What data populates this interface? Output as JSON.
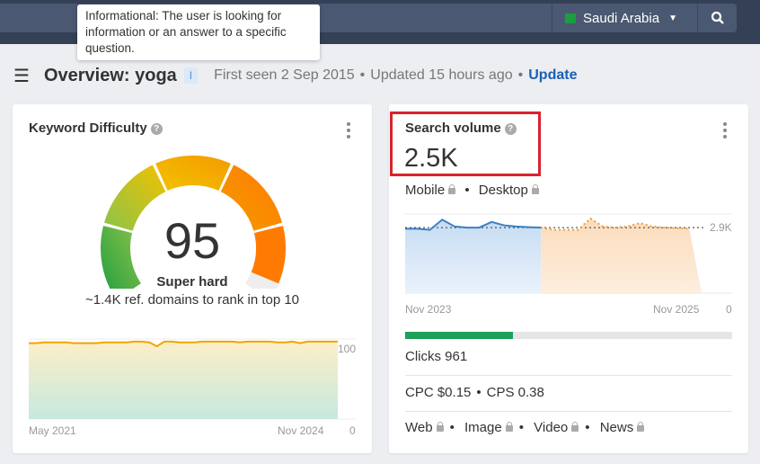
{
  "topbar": {
    "country": "Saudi Arabia",
    "search_icon": "search-icon",
    "flag_icon": "saudi-flag-icon"
  },
  "tooltip": {
    "text": "Informational: The user is looking for information or an answer to a specific question."
  },
  "header": {
    "title": "Overview: yoga",
    "intent_badge": "I",
    "first_seen": "First seen 2 Sep 2015",
    "updated": "Updated 15 hours ago",
    "update_link": "Update"
  },
  "kd": {
    "title": "Keyword Difficulty",
    "value": "95",
    "value_num": 95,
    "label": "Super hard",
    "sub": "~1.4K ref. domains to rank in top 10",
    "gauge_colors": [
      "#1f9d3f",
      "#8bc34a",
      "#f2c200",
      "#f59b00",
      "#ff7a00"
    ],
    "chart_data": {
      "type": "area",
      "x_start": "May 2021",
      "x_end": "Nov 2024",
      "ymax_label": "100",
      "ymin_label": "0",
      "ylim": [
        0,
        100
      ],
      "values": [
        97,
        97,
        98,
        98,
        98,
        98,
        97,
        97,
        97,
        97,
        98,
        98,
        98,
        98,
        99,
        99,
        98,
        93,
        99,
        99,
        98,
        98,
        98,
        99,
        99,
        99,
        99,
        99,
        98,
        99,
        99,
        99,
        99,
        98,
        98,
        99,
        97,
        99,
        99,
        99,
        99,
        99
      ]
    }
  },
  "sv": {
    "title": "Search volume",
    "value": "2.5K",
    "mobile": "Mobile",
    "desktop": "Desktop",
    "highlight_color": "#d9232d",
    "chart_data": {
      "type": "area",
      "x_start": "Nov 2023",
      "x_end": "Nov 2025",
      "ref_label": "2.9K",
      "ref_value": 2900,
      "ymin_label": "0",
      "ylim": [
        0,
        3500
      ],
      "actual": [
        2850,
        2850,
        2800,
        3250,
        2950,
        2900,
        2900,
        3150,
        3000,
        2950,
        2920,
        2900
      ],
      "forecast": [
        2900,
        2800,
        2800,
        2800,
        3300,
        2950,
        2900,
        2950,
        3100,
        2950,
        2900,
        2880,
        2850
      ]
    },
    "clicks": "Clicks 961",
    "clicks_fraction": 0.33,
    "cpc": "CPC $0.15",
    "cps": "CPS 0.38",
    "types": [
      "Web",
      "Image",
      "Video",
      "News"
    ]
  }
}
